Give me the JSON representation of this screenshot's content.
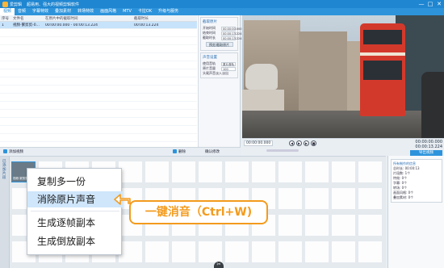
{
  "titlebar": {
    "app_name": "爱剪辑",
    "slogan": "超易用、强大的视频剪辑软件",
    "win_buttons": [
      "—",
      "□",
      "✕"
    ]
  },
  "tabs": [
    "视频",
    "音频",
    "字幕特效",
    "叠加素材",
    "转场特效",
    "画面风格",
    "MTV",
    "卡拉OK",
    "升级与服务"
  ],
  "active_tab_index": 0,
  "clip_table": {
    "headers": [
      "序号",
      "文件名",
      "在原片中的截取时间",
      "截取时长"
    ],
    "rows": [
      [
        "1",
        "视频-繁剪剪-0...",
        "00:00:00.000 - 00:00:13.224",
        "00:00:13.224"
      ]
    ]
  },
  "settings": {
    "trim_header": "截取原片",
    "start_label": "开始时间",
    "end_label": "结束时间",
    "duration_label": "截取时长",
    "start_value": "00:00:00.000",
    "end_value": "00:00:13.224",
    "duration_value": "00:00:13.224",
    "preview_button": "预览/截取原片",
    "audio_header": "声音设置",
    "track_label": "使用音轨",
    "track_value": "原片音轨",
    "volume_label": "原片音量",
    "volume_value": "100",
    "headtail_label": "头尾声音淡入淡出",
    "confirm_button": "确认修改"
  },
  "bottom_tools": {
    "add_video": "添加视频",
    "delete": "删除",
    "confirm": "确认修改"
  },
  "player": {
    "timecode": "00:00:00.000",
    "position_label": "00:00:00.000",
    "total_label": "00:00:13.224",
    "export_button": "导出视频"
  },
  "storyboard": {
    "side_tab": "已添加片段",
    "first_clip_label": "视频-繁剪剪-..."
  },
  "properties": {
    "header": "所有制作的信息",
    "lines": [
      "总时长: 00:00:13",
      "片段数: 1个",
      "特效: 0个",
      "字幕: 0个",
      "转场: 0个",
      "画面风格: 0个",
      "叠加素材: 0个",
      "卡拉OK: 0个"
    ]
  },
  "context_menu": {
    "items": [
      "复制多一份",
      "消除原片声音",
      "生成逐帧副本",
      "生成倒放副本"
    ],
    "highlighted_index": 1
  },
  "callout": {
    "text": "一键消音（Ctrl+W)"
  },
  "colors": {
    "title_blue": "#1f86d1",
    "accent_orange": "#f39b1d",
    "menu_highlight": "#cfe6fb"
  }
}
